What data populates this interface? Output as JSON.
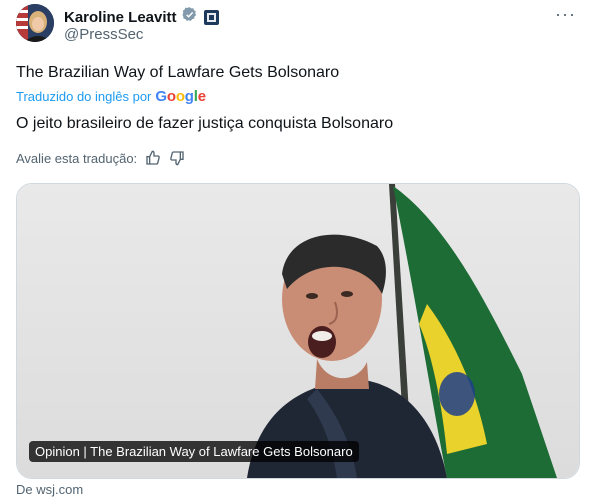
{
  "author": {
    "name": "Karoline Leavitt",
    "handle": "@PressSec"
  },
  "menu": {
    "more_glyph": "···"
  },
  "tweet": {
    "text": "The Brazilian Way of Lawfare Gets Bolsonaro",
    "translated_by_prefix": "Traduzido do inglês por",
    "google_wordmark": "Google",
    "translation": "O jeito brasileiro de fazer justiça conquista Bolsonaro",
    "rate_label": "Avalie esta tradução:"
  },
  "card": {
    "title": "Opinion | The Brazilian Way of Lawfare Gets Bolsonaro",
    "source": "De wsj.com"
  },
  "colors": {
    "accent": "#1d9bf0",
    "verified": "#829aab",
    "text_secondary": "#536471"
  },
  "icons": [
    "verified-badge-icon",
    "government-badge-icon",
    "more-icon",
    "thumbs-up-icon",
    "thumbs-down-icon"
  ]
}
